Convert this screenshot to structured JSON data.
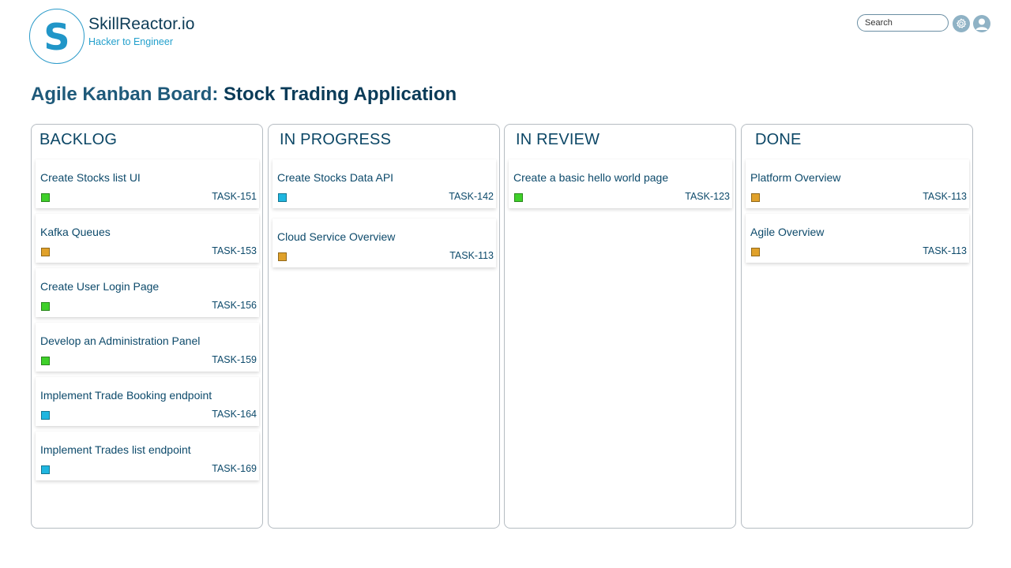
{
  "header": {
    "logo_letter": "S",
    "brand_name": "SkillReactor.io",
    "tagline": "Hacker to Engineer",
    "search_placeholder": "Search",
    "settings_icon": "gear-icon",
    "profile_icon": "user-avatar-icon"
  },
  "board": {
    "title_prefix": "Agile Kanban Board: ",
    "title_project": "Stock Trading Application"
  },
  "colors": {
    "green": "#3fd02a",
    "blue": "#1fb6e0",
    "orange": "#e0a12a"
  },
  "columns": [
    {
      "title": "BACKLOG",
      "cards": [
        {
          "title": "Create Stocks list UI",
          "id": "TASK-151",
          "color": "green"
        },
        {
          "title": "Kafka Queues",
          "id": "TASK-153",
          "color": "orange"
        },
        {
          "title": "Create User Login Page",
          "id": "TASK-156",
          "color": "green"
        },
        {
          "title": "Develop an Administration Panel",
          "id": "TASK-159",
          "color": "green"
        },
        {
          "title": "Implement Trade Booking endpoint",
          "id": "TASK-164",
          "color": "blue"
        },
        {
          "title": "Implement Trades list endpoint",
          "id": "TASK-169",
          "color": "blue"
        }
      ]
    },
    {
      "title": "IN PROGRESS",
      "cards": [
        {
          "title": "Create Stocks Data API",
          "id": "TASK-142",
          "color": "blue"
        },
        {
          "title": "Cloud Service Overview",
          "id": "TASK-113",
          "color": "orange"
        }
      ]
    },
    {
      "title": "IN REVIEW",
      "cards": [
        {
          "title": "Create a basic hello world page",
          "id": "TASK-123",
          "color": "green"
        }
      ]
    },
    {
      "title": "DONE",
      "cards": [
        {
          "title": "Platform Overview",
          "id": "TASK-113",
          "color": "orange"
        },
        {
          "title": "Agile Overview",
          "id": "TASK-113",
          "color": "orange"
        }
      ]
    }
  ]
}
